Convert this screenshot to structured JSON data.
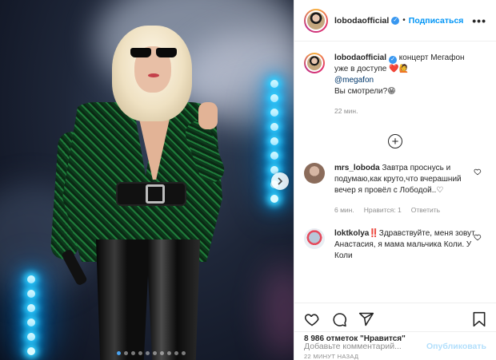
{
  "post": {
    "username": "lobodaofficial",
    "follow_label": "Подписаться",
    "separator": "•",
    "more_label": "•••",
    "caption": {
      "username": "lobodaofficial",
      "text_line1": " концерт Мегафон уже в доступе",
      "emoji1": "❤️🙋",
      "mention": "@megafon",
      "text_line3": "Вы смотрели?😁",
      "time": "22 мин."
    },
    "add_button": "+",
    "comments": [
      {
        "username": "mrs_loboda",
        "text": " Завтра проснусь и подумаю,как круто,что вчерашний вечер я провёл с Лободой..♡",
        "time": "6 мин.",
        "likes": "Нравится: 1",
        "reply": "Ответить"
      },
      {
        "username": "loktkolya",
        "text": "‼️Здравствуйте, меня зовут Анастасия, я мама мальчика Коли. У Коли"
      }
    ],
    "likes_count": "8 986 отметок \"Нравится\"",
    "posted_time": "22 МИНУТ НАЗАД",
    "comment_placeholder": "Добавьте комментарий...",
    "publish_label": "Опубликовать"
  },
  "carousel": {
    "total": 10,
    "active_index": 0
  },
  "colors": {
    "accent": "#0095f6",
    "verified": "#3897f0",
    "heart": "#ed4956"
  }
}
